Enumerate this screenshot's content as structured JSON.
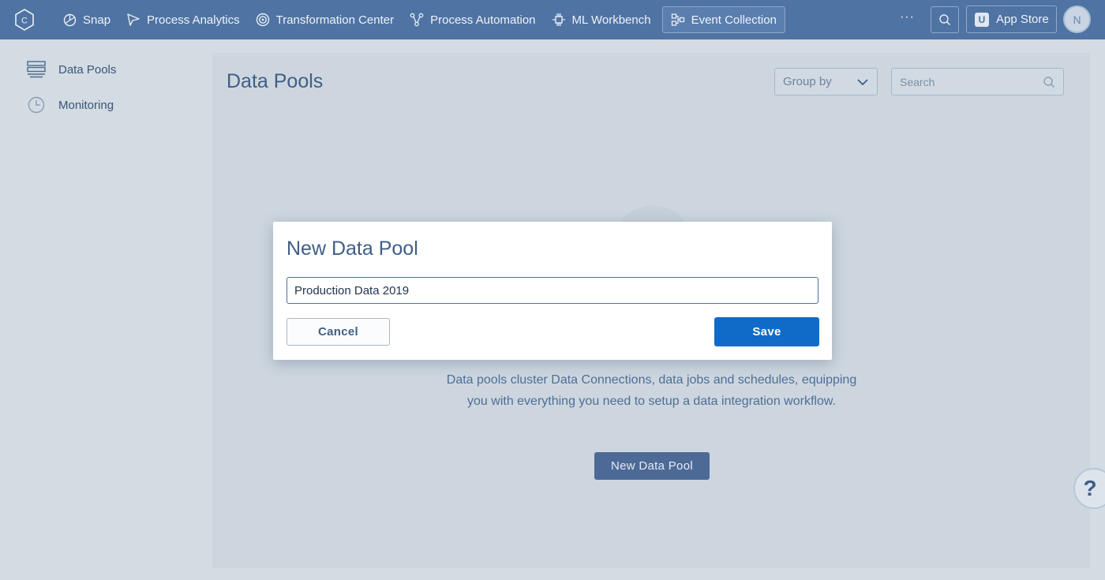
{
  "nav": {
    "logo_letter": "C",
    "items": [
      {
        "label": "Snap",
        "icon": "snap-icon"
      },
      {
        "label": "Process Analytics",
        "icon": "analytics-icon"
      },
      {
        "label": "Transformation Center",
        "icon": "target-icon"
      },
      {
        "label": "Process Automation",
        "icon": "automation-icon"
      },
      {
        "label": "ML Workbench",
        "icon": "workbench-icon"
      },
      {
        "label": "Event Collection",
        "icon": "event-collection-icon",
        "active": true
      }
    ],
    "more": "···",
    "app_store": "App Store",
    "app_store_badge": "U",
    "avatar_initial": "N"
  },
  "sidebar": {
    "items": [
      {
        "label": "Data Pools",
        "icon": "data-pools-icon"
      },
      {
        "label": "Monitoring",
        "icon": "monitoring-icon"
      }
    ]
  },
  "main": {
    "title": "Data Pools",
    "group_by": "Group by",
    "search_placeholder": "Search",
    "empty_text": "Data pools cluster Data Connections, data jobs and schedules, equipping you with everything you need to setup a data integration workflow.",
    "new_pool_button": "New Data Pool"
  },
  "help": {
    "label": "?"
  },
  "modal": {
    "title": "New Data Pool",
    "input_value": "Production Data 2019",
    "cancel": "Cancel",
    "save": "Save"
  },
  "colors": {
    "nav_bg": "#4f73a3",
    "save_button": "#0f6bc7",
    "overlay_bg": "#d3dbe3"
  }
}
